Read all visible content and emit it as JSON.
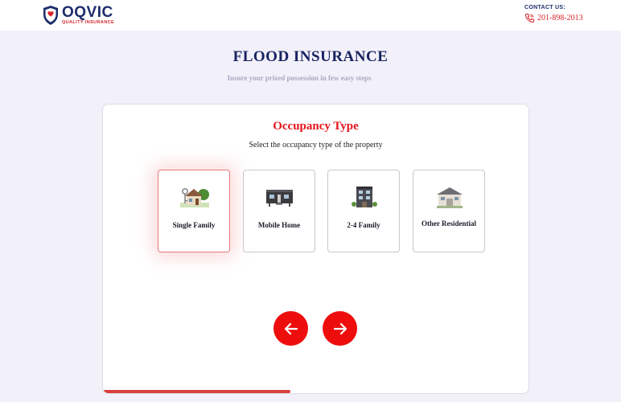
{
  "header": {
    "brand": "OQVIC",
    "tagline": "QUALITY INSURANCE",
    "contact_label": "CONTACT US:",
    "phone": "201-898-2013"
  },
  "page": {
    "title": "FLOOD INSURANCE",
    "subtitle": "Insure your prized possession in few easy steps"
  },
  "card": {
    "title": "Occupancy Type",
    "subtitle": "Select the occupancy type of the property",
    "options": [
      {
        "label": "Single Family",
        "icon": "single-family-house-icon",
        "selected": true
      },
      {
        "label": "Mobile Home",
        "icon": "mobile-home-icon",
        "selected": false
      },
      {
        "label": "2-4 Family",
        "icon": "multi-family-building-icon",
        "selected": false
      },
      {
        "label": "Other Residential",
        "icon": "residential-house-icon",
        "selected": false
      }
    ],
    "progress_percent": 44
  },
  "colors": {
    "accent": "#ee0d0d",
    "brand_navy": "#1d2c6b",
    "background": "#f2f1fa"
  }
}
